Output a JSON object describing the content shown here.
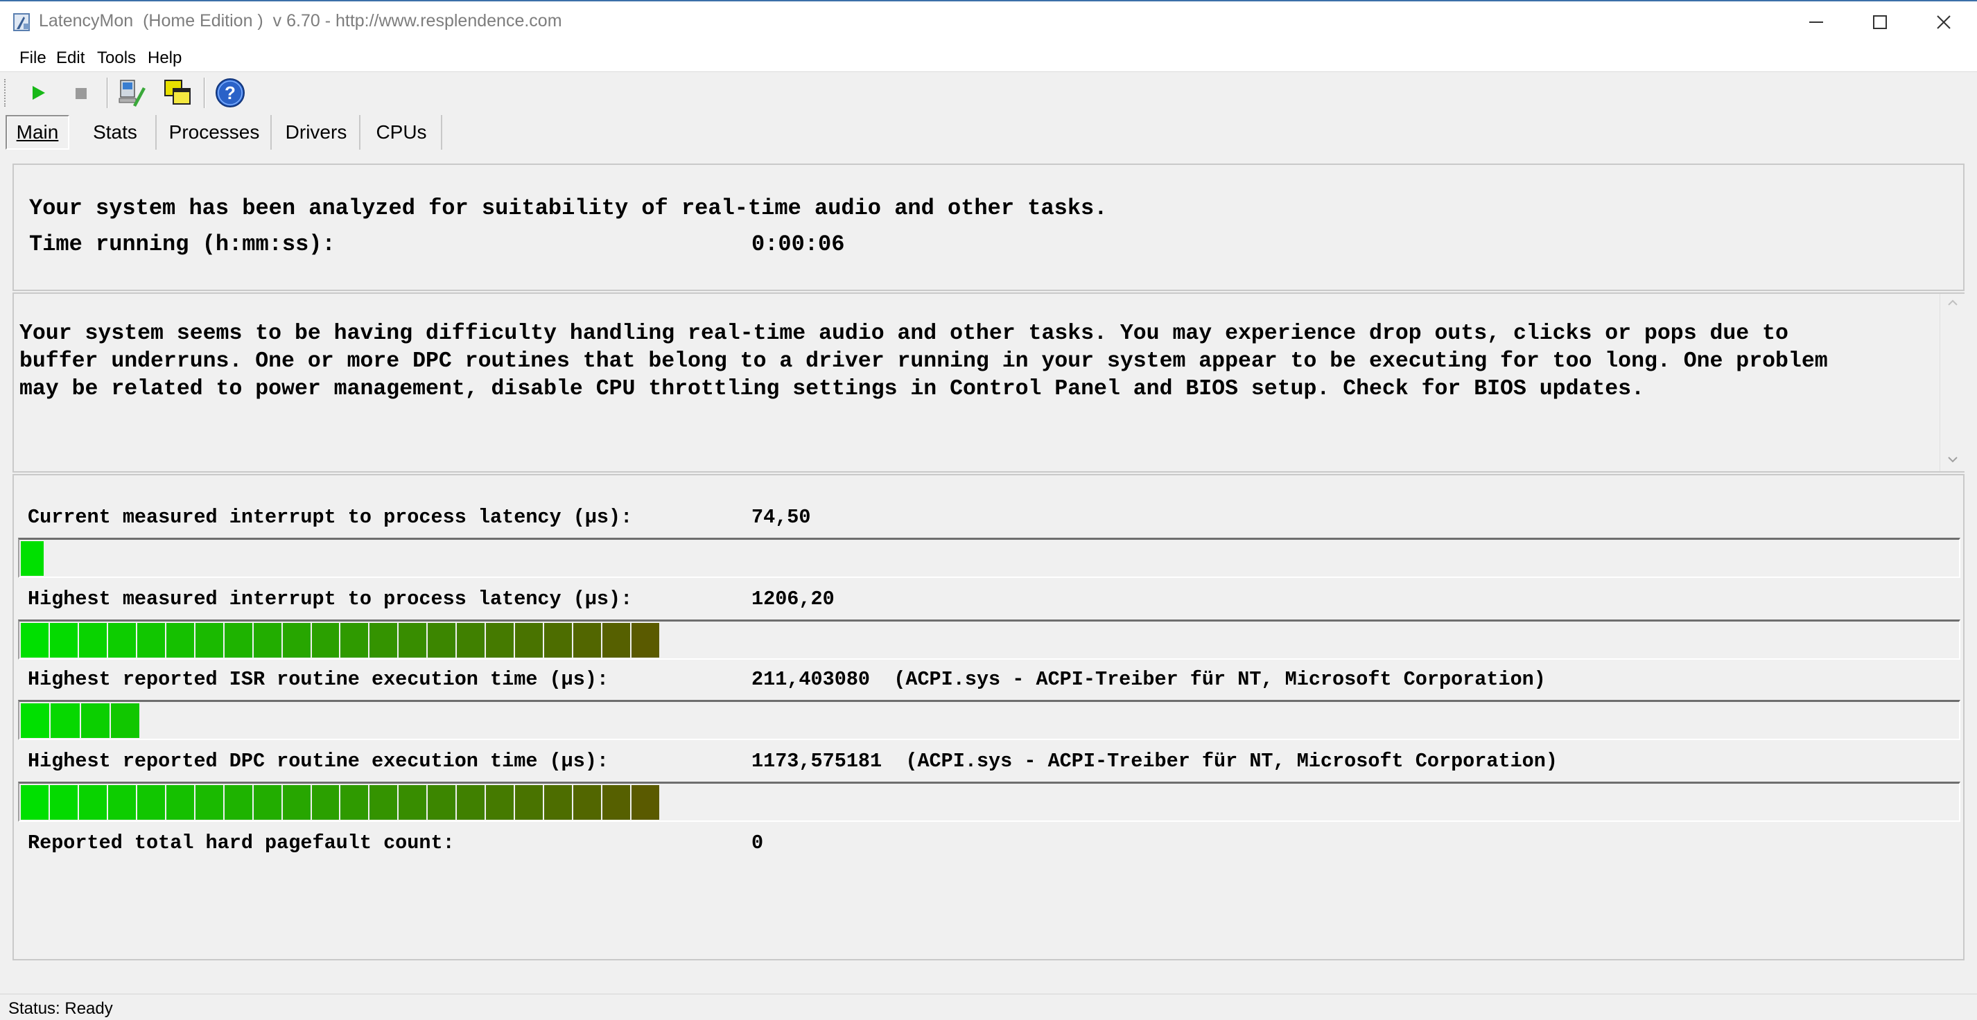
{
  "window": {
    "title": "LatencyMon  (Home Edition )  v 6.70 - http://www.resplendence.com"
  },
  "menu": [
    "File",
    "Edit",
    "Tools",
    "Help"
  ],
  "toolbar": {
    "icons": [
      "play-icon",
      "stop-icon",
      "computer-icon",
      "windows-icon",
      "help-icon"
    ]
  },
  "tabs": [
    {
      "label": "Main",
      "active": true
    },
    {
      "label": "Stats"
    },
    {
      "label": "Processes"
    },
    {
      "label": "Drivers"
    },
    {
      "label": "CPUs"
    }
  ],
  "summary": {
    "line1": "Your system has been analyzed for suitability of real-time audio and other tasks.",
    "time_label": "Time running (h:mm:ss):",
    "time_value": "0:00:06"
  },
  "message": {
    "line1": "Your system seems to be having difficulty handling real-time audio and other tasks. You may experience drop outs, clicks or pops due to",
    "line2": "buffer underruns. One or more DPC routines that belong to a driver running in your system appear to be executing for too long. One problem",
    "line3": "may be related to power management, disable CPU throttling settings in Control Panel and BIOS setup. Check for BIOS updates."
  },
  "metrics": [
    {
      "label": "Current measured interrupt to process latency (µs):",
      "value": "74,50",
      "bar_fraction": 0.0125
    },
    {
      "label": "Highest measured interrupt to process latency (µs):",
      "value": "1206,20",
      "bar_fraction": 0.33
    },
    {
      "label": "Highest reported ISR routine execution time (µs):",
      "value": "211,403080  (ACPI.sys - ACPI-Treiber für NT, Microsoft Corporation)",
      "bar_fraction": 0.062
    },
    {
      "label": "Highest reported DPC routine execution time (µs):",
      "value": "1173,575181  (ACPI.sys - ACPI-Treiber für NT, Microsoft Corporation)",
      "bar_fraction": 0.33
    },
    {
      "label": "Reported total hard pagefault count:",
      "value": "0"
    }
  ],
  "status": {
    "text": "Status: Ready"
  },
  "colors": {
    "bar_start": "#00e000",
    "bar_end": "#5a5a00",
    "title_bar_accent": "#3b6fa8"
  }
}
